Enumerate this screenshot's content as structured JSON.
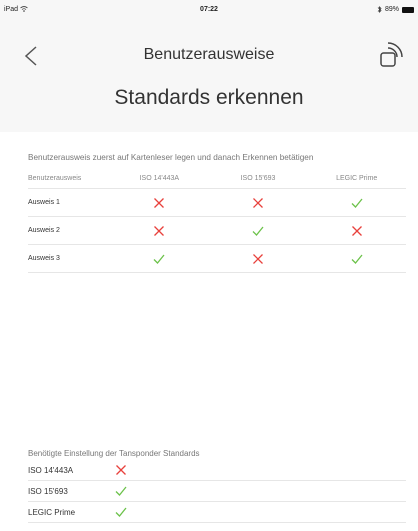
{
  "status": {
    "device": "iPad",
    "time": "07:22",
    "battery": "89%"
  },
  "header": {
    "title": "Benutzerausweise",
    "subtitle": "Standards erkennen"
  },
  "instruction": "Benutzerausweis zuerst auf Kartenleser legen und danach Erkennen betätigen",
  "table": {
    "columns": [
      "Benutzerausweis",
      "ISO 14'443A",
      "ISO 15'693",
      "LEGIC Prime"
    ],
    "rows": [
      {
        "name": "Ausweis 1",
        "results": [
          "fail",
          "fail",
          "pass"
        ]
      },
      {
        "name": "Ausweis 2",
        "results": [
          "fail",
          "pass",
          "fail"
        ]
      },
      {
        "name": "Ausweis 3",
        "results": [
          "pass",
          "fail",
          "pass"
        ]
      }
    ]
  },
  "required_section": {
    "label": "Benötigte Einstellung der Tansponder Standards",
    "items": [
      {
        "name": "ISO 14'443A",
        "result": "fail"
      },
      {
        "name": "ISO 15'693",
        "result": "pass"
      },
      {
        "name": "LEGIC Prime",
        "result": "pass"
      }
    ]
  },
  "colors": {
    "pass": "#6cc24a",
    "fail": "#e8413c",
    "header_bg": "#f7f7f7"
  },
  "icons": {
    "back": "chevron-left-icon",
    "connect": "reader-connect-icon",
    "pass": "check-icon",
    "fail": "cross-icon",
    "wifi": "wifi-icon",
    "bluetooth": "bluetooth-icon",
    "battery": "battery-icon"
  }
}
